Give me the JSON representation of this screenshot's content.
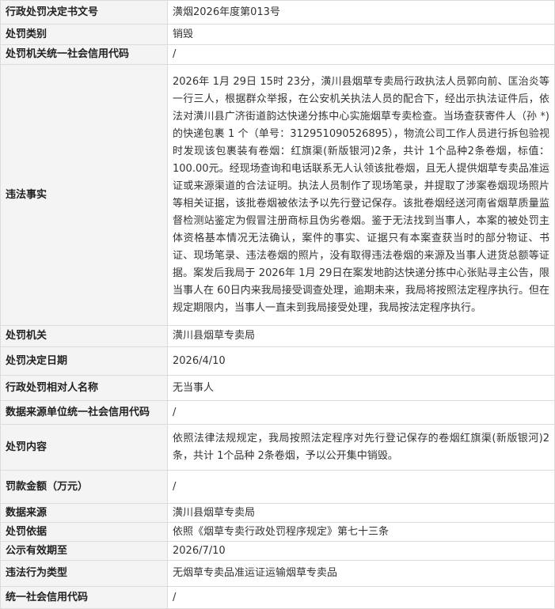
{
  "rows": [
    {
      "label": "行政处罚决定书文号",
      "value": "潢烟2026年度第013号"
    },
    {
      "label": "处罚类别",
      "value": "销毁"
    },
    {
      "label": "处罚机关统一社会信用代码",
      "value": "/"
    },
    {
      "label": "违法事实",
      "value": "2026年 1月 29日 15时 23分，潢川县烟草专卖局行政执法人员郭向前、匡治炎等一行三人，根据群众举报，在公安机关执法人员的配合下，经出示执法证件后，依法对潢川县广济街道韵达快递分拣中心实施烟草专卖检查。当场查获寄件人（孙 *)的快递包裹 1 个（单号：312951090526895），物流公司工作人员进行拆包验视时发现该包裹装有卷烟：红旗渠(新版银河)2条，共计 1个品种2条卷烟，标值：100.00元。经现场查询和电话联系无人认领该批卷烟，且无人提供烟草专卖品准运证或来源渠道的合法证明。执法人员制作了现场笔录，并提取了涉案卷烟现场照片等相关证据，该批卷烟被依法予以先行登记保存。该批卷烟经送河南省烟草质量监督检测站鉴定为假冒注册商标且伪劣卷烟。鉴于无法找到当事人，本案的被处罚主体资格基本情况无法确认，案件的事实、证据只有本案查获当时的部分物证、书证、现场笔录、违法卷烟的照片，没有取得违法卷烟的来源及当事人进货总额等证据。案发后我局于 2026年 1月 29日在案发地韵达快递分拣中心张贴寻主公告，限当事人在 60日内来我局接受调查处理，逾期未来，我局将按照法定程序执行。但在规定期限内，当事人一直未到我局接受处理，我局按法定程序执行。"
    },
    {
      "label": "处罚机关",
      "value": "潢川县烟草专卖局"
    },
    {
      "label": "处罚决定日期",
      "value": "2026/4/10"
    },
    {
      "label": "行政处罚相对人名称",
      "value": "无当事人"
    },
    {
      "label": "数据来源单位统一社会信用代码",
      "value": "/"
    },
    {
      "label": "处罚内容",
      "value": "依照法律法规规定，我局按照法定程序对先行登记保存的卷烟红旗渠(新版银河)2条，共计 1个品种 2条卷烟，予以公开集中销毁。"
    },
    {
      "label": "罚款金额（万元）",
      "value": "/"
    },
    {
      "label": "数据来源",
      "value": "潢川县烟草专卖局"
    },
    {
      "label": "处罚依据",
      "value": "依照《烟草专卖行政处罚程序规定》第七十三条"
    },
    {
      "label": "公示有效期至",
      "value": "2026/7/10"
    },
    {
      "label": "违法行为类型",
      "value": "无烟草专卖品准运证运输烟草专卖品"
    },
    {
      "label": "统一社会信用代码",
      "value": "/"
    }
  ]
}
